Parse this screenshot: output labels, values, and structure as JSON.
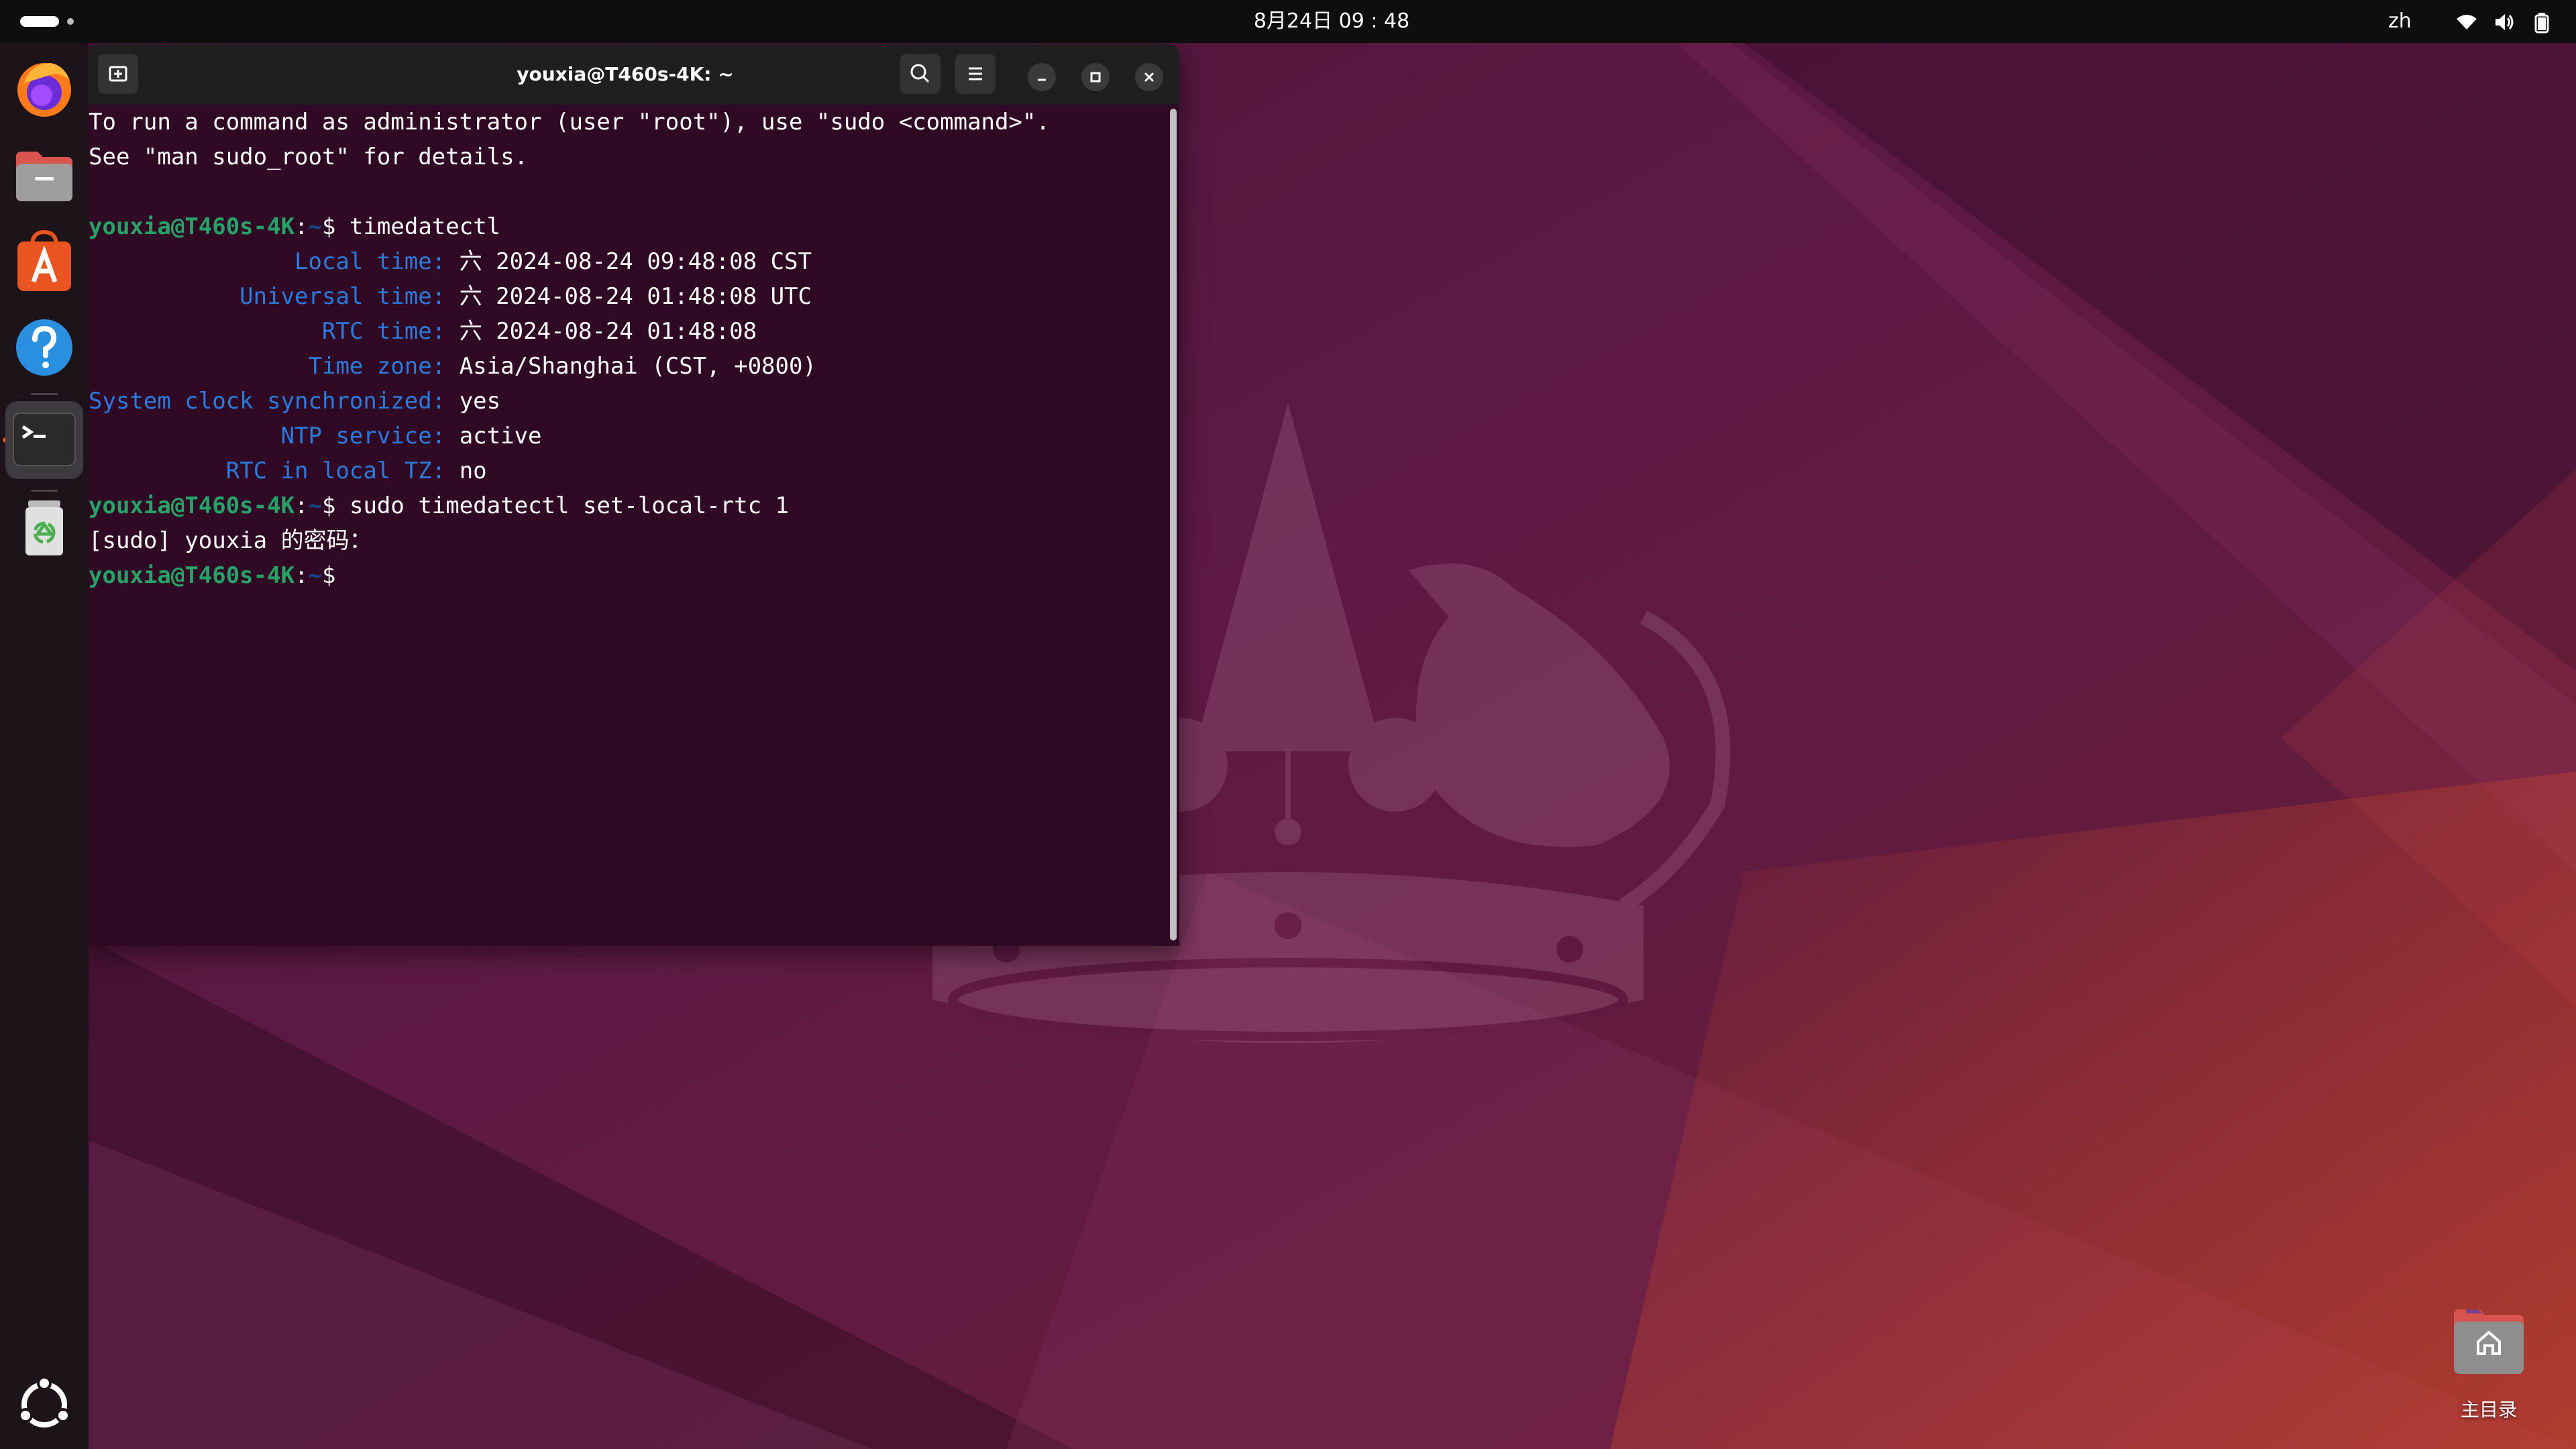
{
  "topbar": {
    "clock": "8月24日 09 : 48",
    "input_method": "zh",
    "icons": [
      "activities-indicator",
      "wifi-icon",
      "volume-icon",
      "battery-icon"
    ]
  },
  "dock": {
    "apps": [
      {
        "name": "Firefox",
        "icon": "firefox-icon"
      },
      {
        "name": "Files",
        "icon": "files-icon"
      },
      {
        "name": "App Center",
        "icon": "app-center-icon"
      },
      {
        "name": "Help",
        "icon": "help-icon"
      },
      {
        "name": "Terminal",
        "icon": "terminal-icon",
        "running": true
      },
      {
        "name": "Trash",
        "icon": "trash-icon"
      }
    ],
    "show_apps_icon": "ubuntu-logo-icon"
  },
  "terminal": {
    "title": "youxia@T460s-4K: ~",
    "header_buttons": [
      "new-tab-icon",
      "search-icon",
      "menu-icon",
      "minimize-icon",
      "maximize-icon",
      "close-icon"
    ],
    "prompt": {
      "user_host": "youxia@T460s-4K",
      "path": "~",
      "symbol": "$"
    },
    "intro": [
      "To run a command as administrator (user \"root\"), use \"sudo <command>\".",
      "See \"man sudo_root\" for details."
    ],
    "commands": {
      "cmd1": "timedatectl",
      "cmd2": "sudo timedatectl set-local-rtc 1"
    },
    "timedatectl": [
      {
        "field": "Local time",
        "value": "六 2024-08-24 09:48:08 CST"
      },
      {
        "field": "Universal time",
        "value": "六 2024-08-24 01:48:08 UTC"
      },
      {
        "field": "RTC time",
        "value": "六 2024-08-24 01:48:08"
      },
      {
        "field": "Time zone",
        "value": "Asia/Shanghai (CST, +0800)"
      },
      {
        "field": "System clock synchronized",
        "value": "yes"
      },
      {
        "field": "NTP service",
        "value": "active"
      },
      {
        "field": "RTC in local TZ",
        "value": "no"
      }
    ],
    "sudo_prompt": "[sudo] youxia 的密码："
  },
  "desktop": {
    "home_label": "主目录"
  },
  "colors": {
    "terminal_bg": "#300a24",
    "prompt_user": "#26a269",
    "prompt_path": "#12488b",
    "field_label": "#2a7bde",
    "accent": "#e95420"
  }
}
